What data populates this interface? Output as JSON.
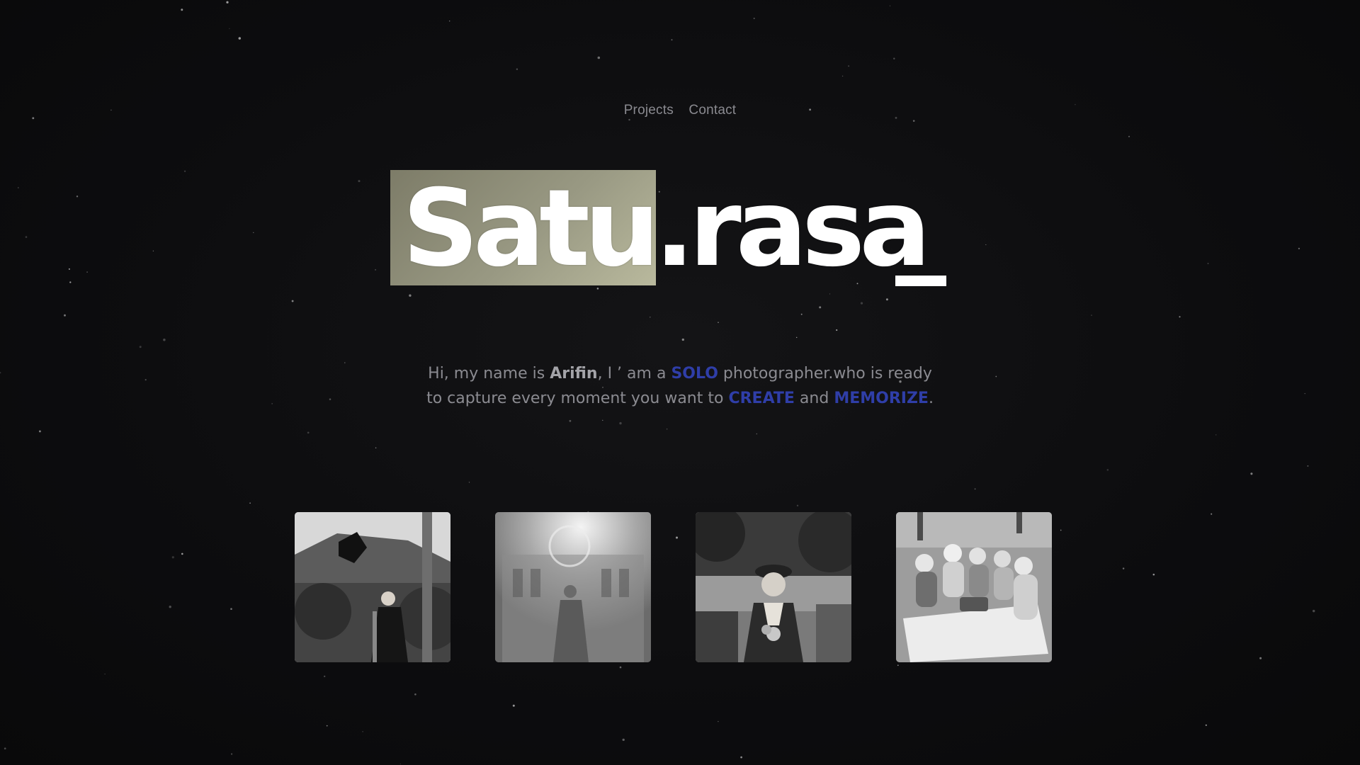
{
  "nav": {
    "projects": "Projects",
    "contact": "Contact"
  },
  "logo": {
    "text": "Satu.rasa"
  },
  "intro": {
    "line1_pre": "Hi, my name is ",
    "name": "Arifin",
    "line1_mid": ", I ’ am a ",
    "solo": "SOLO",
    "line1_post": " photographer.who is ready",
    "line2_pre": "to capture every moment you want to ",
    "create": "CREATE",
    "and": " and ",
    "memorize": "MEMORIZE",
    "line2_post": "."
  },
  "colors": {
    "background": "#0d0d0f",
    "accent": "#2f3ea8",
    "logo_highlight": "#9a9a84",
    "text": "#8b8b91"
  },
  "gallery": {
    "photos": [
      {
        "subject": "graduate tossing cap in garden"
      },
      {
        "subject": "backlit figure in front of building"
      },
      {
        "subject": "woman with beret holding flowers"
      },
      {
        "subject": "group picnic on grass"
      }
    ]
  }
}
